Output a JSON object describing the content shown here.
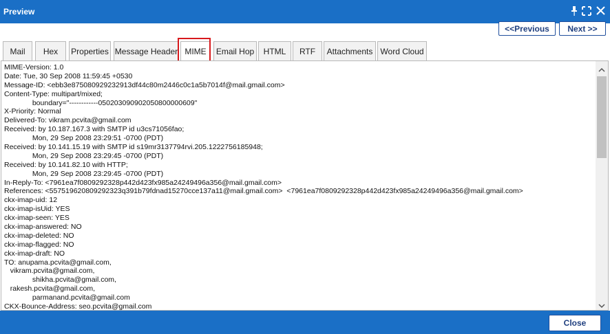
{
  "window": {
    "title": "Preview"
  },
  "toolbar": {
    "previous_label": "<<Previous",
    "next_label": "Next >>"
  },
  "tabs": [
    {
      "label": "Mail"
    },
    {
      "label": "Hex"
    },
    {
      "label": "Properties"
    },
    {
      "label": "Message Header"
    },
    {
      "label": "MIME",
      "active": true
    },
    {
      "label": "Email Hop"
    },
    {
      "label": "HTML"
    },
    {
      "label": "RTF"
    },
    {
      "label": "Attachments"
    },
    {
      "label": "Word Cloud"
    }
  ],
  "mime_lines": [
    "MIME-Version: 1.0",
    "Date: Tue, 30 Sep 2008 11:59:45 +0530",
    "Message-ID: <ebb3e875080929232913df44c80m2446c0c1a5b7014f@mail.gmail.com>",
    "Content-Type: multipart/mixed;",
    "              boundary=\"------------050203090902050800000609\"",
    "X-Priority: Normal",
    "Delivered-To: vikram.pcvita@gmail.com",
    "Received: by 10.187.167.3 with SMTP id u3cs71056fao;",
    "              Mon, 29 Sep 2008 23:29:51 -0700 (PDT)",
    "Received: by 10.141.15.19 with SMTP id s19mr3137794rvi.205.1222756185948;",
    "              Mon, 29 Sep 2008 23:29:45 -0700 (PDT)",
    "Received: by 10.141.82.10 with HTTP;",
    "              Mon, 29 Sep 2008 23:29:45 -0700 (PDT)",
    "In-Reply-To: <7961ea7f0809292328p442d423fx985a24249496a356@mail.gmail.com>",
    "References: <557519620809292323q391b79fdnad15270cce137a11@mail.gmail.com>  <7961ea7f0809292328p442d423fx985a24249496a356@mail.gmail.com>",
    "ckx-imap-uid: 12",
    "ckx-imap-isUid: YES",
    "ckx-imap-seen: YES",
    "ckx-imap-answered: NO",
    "ckx-imap-deleted: NO",
    "ckx-imap-flagged: NO",
    "ckx-imap-draft: NO",
    "TO: anupama.pcvita@gmail.com,",
    "   vikram.pcvita@gmail.com,",
    "              shikha.pcvita@gmail.com,",
    "   rakesh.pcvita@gmail.com,",
    "              parmanand.pcvita@gmail.com",
    "CKX-Bounce-Address: seo.pcvita@gmail.com"
  ],
  "footer": {
    "close_label": "Close"
  },
  "colors": {
    "titlebar": "#1a6fc6",
    "highlight": "#d7191c",
    "button_text": "#1f3f7f"
  },
  "icons": {
    "pin": "pin-icon",
    "maximize": "maximize-icon",
    "close": "close-icon"
  }
}
